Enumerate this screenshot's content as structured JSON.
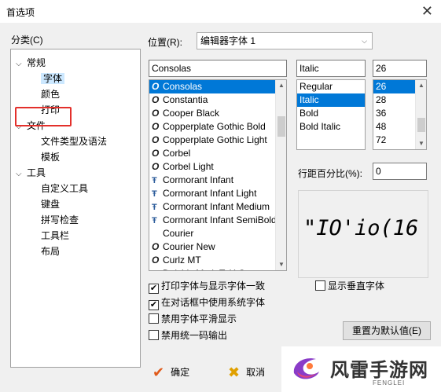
{
  "window": {
    "title": "首选项",
    "close_glyph": "✕"
  },
  "category": {
    "label": "分类(C)",
    "tree": [
      {
        "label": "常规",
        "level": 0,
        "expanded": true
      },
      {
        "label": "字体",
        "level": 1,
        "selected": true
      },
      {
        "label": "颜色",
        "level": 1
      },
      {
        "label": "打印",
        "level": 1
      },
      {
        "label": "文件",
        "level": 0,
        "expanded": true
      },
      {
        "label": "文件类型及语法",
        "level": 1
      },
      {
        "label": "模板",
        "level": 1
      },
      {
        "label": "工具",
        "level": 0,
        "expanded": true
      },
      {
        "label": "自定义工具",
        "level": 1
      },
      {
        "label": "键盘",
        "level": 1
      },
      {
        "label": "拼写检查",
        "level": 1
      },
      {
        "label": "工具栏",
        "level": 1
      },
      {
        "label": "布局",
        "level": 1
      }
    ]
  },
  "position": {
    "label": "位置(R):",
    "value": "编辑器字体 1"
  },
  "font": {
    "name_value": "Consolas",
    "style_value": "Italic",
    "size_value": "26",
    "fonts": [
      {
        "name": "Consolas",
        "icon": "O",
        "selected": true
      },
      {
        "name": "Constantia",
        "icon": "O"
      },
      {
        "name": "Cooper Black",
        "icon": "O"
      },
      {
        "name": "Copperplate Gothic Bold",
        "icon": "O"
      },
      {
        "name": "Copperplate Gothic Light",
        "icon": "O"
      },
      {
        "name": "Corbel",
        "icon": "O"
      },
      {
        "name": "Corbel Light",
        "icon": "O"
      },
      {
        "name": "Cormorant Infant",
        "icon": "TT"
      },
      {
        "name": "Cormorant Infant Light",
        "icon": "TT"
      },
      {
        "name": "Cormorant Infant Medium",
        "icon": "TT"
      },
      {
        "name": "Cormorant Infant SemiBold",
        "icon": "TT"
      },
      {
        "name": "Courier",
        "icon": ""
      },
      {
        "name": "Courier New",
        "icon": "O"
      },
      {
        "name": "Curlz MT",
        "icon": "O"
      },
      {
        "name": "DejaVu Math TeX Gyre",
        "icon": "TT"
      }
    ],
    "styles": [
      {
        "name": "Regular"
      },
      {
        "name": "Italic",
        "selected": true
      },
      {
        "name": "Bold"
      },
      {
        "name": "Bold Italic"
      }
    ],
    "sizes": [
      {
        "name": "26",
        "selected": true
      },
      {
        "name": "28"
      },
      {
        "name": "36"
      },
      {
        "name": "48"
      },
      {
        "name": "72"
      }
    ]
  },
  "spacing": {
    "label": "行距百分比(%):",
    "value": "0"
  },
  "preview": {
    "text": "\"IO'io(16"
  },
  "options": {
    "print_same": {
      "label": "打印字体与显示字体一致",
      "checked": true
    },
    "system_font": {
      "label": "在对话框中使用系统字体",
      "checked": true
    },
    "no_smoothing": {
      "label": "禁用字体平滑显示",
      "checked": false
    },
    "no_unicode": {
      "label": "禁用统一码输出",
      "checked": false
    },
    "vertical_font": {
      "label": "显示垂直字体",
      "checked": false
    }
  },
  "buttons": {
    "reset_label": "重置为默认值(E)",
    "ok_label": "确定",
    "cancel_label": "取消"
  },
  "icons": {
    "check": "✔",
    "ok": "✔",
    "cancel": "✖",
    "chevron_down": "⌵",
    "scroll_up": "▲",
    "scroll_down": "▼"
  },
  "watermark": {
    "text": "风雷手游网",
    "sub": "FENGLEI"
  },
  "colors": {
    "selection": "#0078d7",
    "highlight_box": "#e3302b",
    "tree_selected": "#cce8ff"
  }
}
